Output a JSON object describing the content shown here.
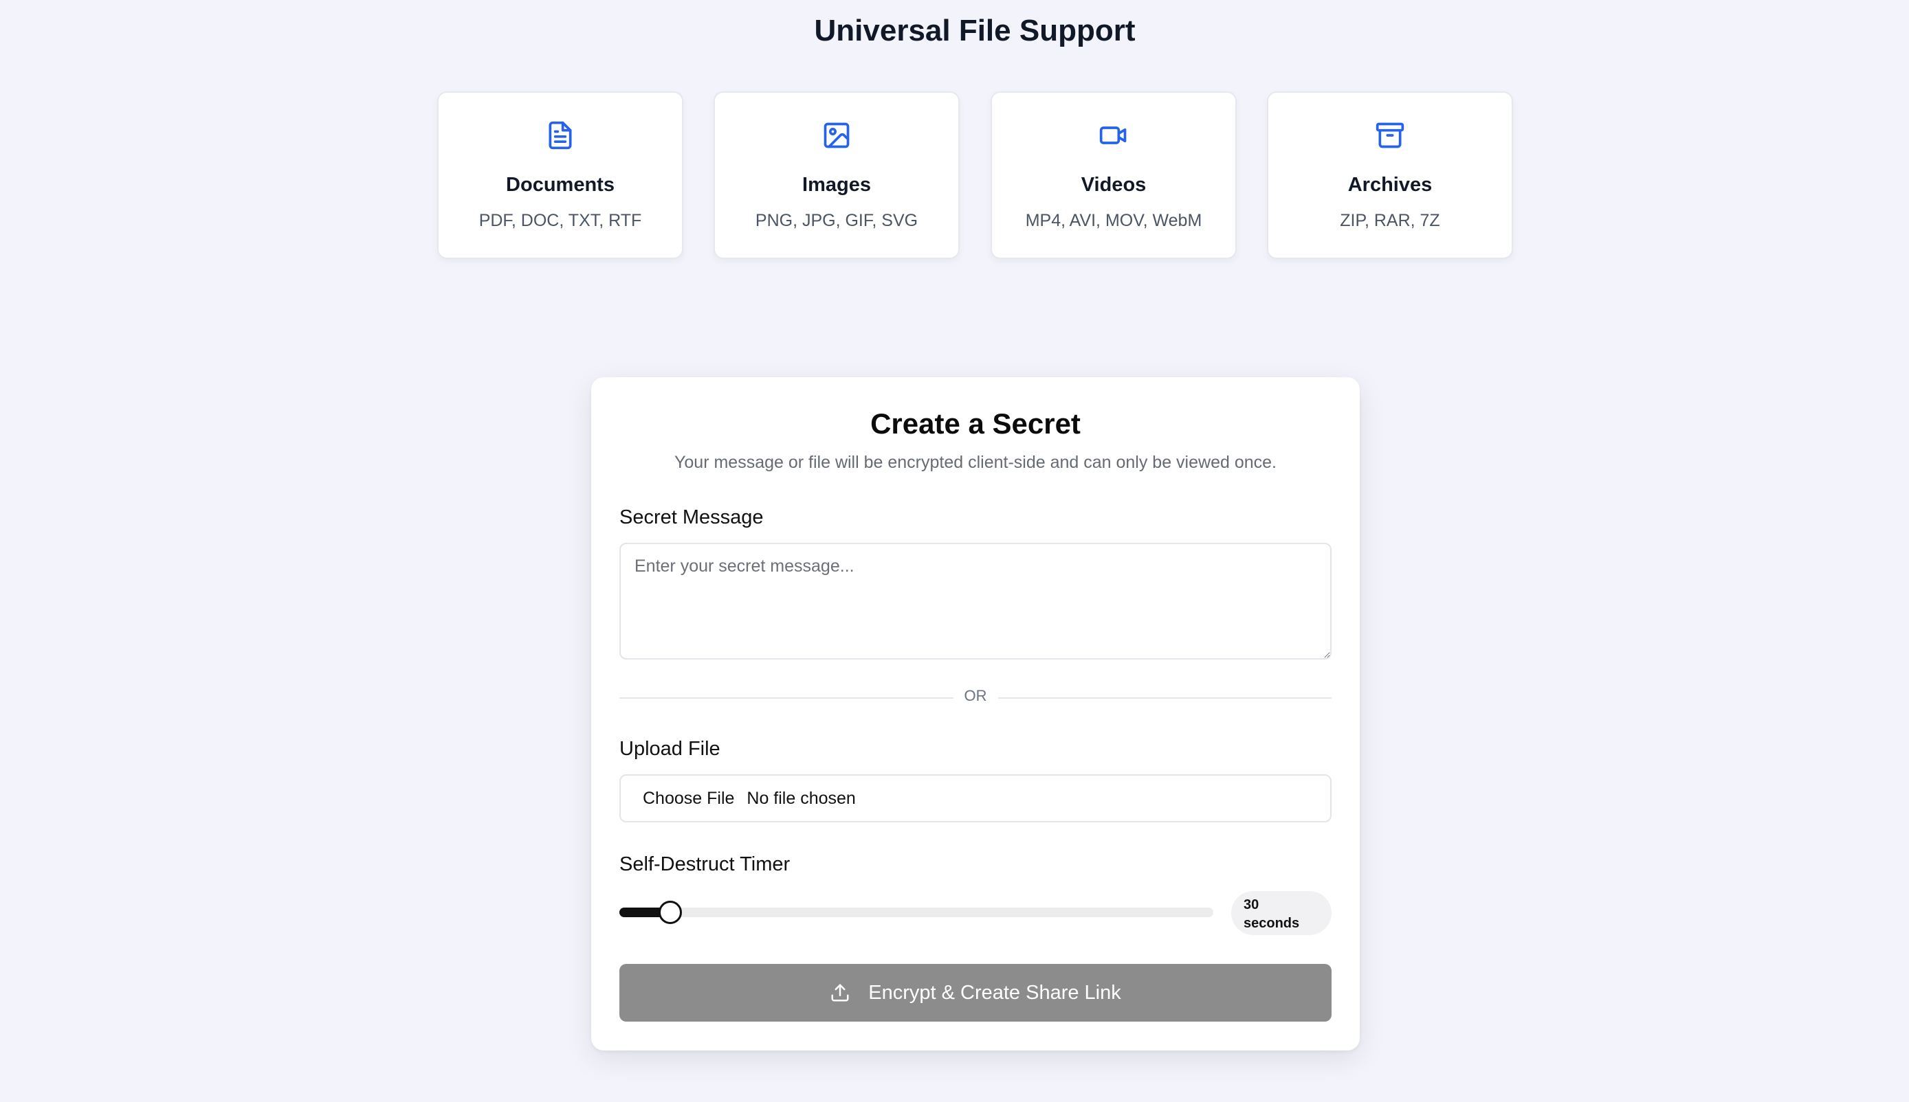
{
  "file_support": {
    "title": "Universal File Support",
    "cards": [
      {
        "icon": "document-icon",
        "title": "Documents",
        "formats": "PDF, DOC, TXT, RTF"
      },
      {
        "icon": "image-icon",
        "title": "Images",
        "formats": "PNG, JPG, GIF, SVG"
      },
      {
        "icon": "video-icon",
        "title": "Videos",
        "formats": "MP4, AVI, MOV, WebM"
      },
      {
        "icon": "archive-icon",
        "title": "Archives",
        "formats": "ZIP, RAR, 7Z"
      }
    ]
  },
  "form": {
    "title": "Create a Secret",
    "subtitle": "Your message or file will be encrypted client-side and can only be viewed once.",
    "message_label": "Secret Message",
    "message_placeholder": "Enter your secret message...",
    "message_value": "",
    "divider_text": "OR",
    "upload_label": "Upload File",
    "choose_file_label": "Choose File",
    "file_status": "No file chosen",
    "timer_label": "Self-Destruct Timer",
    "timer_value_text": "30",
    "timer_unit_text": "seconds",
    "timer_slider_fraction": 0.086,
    "submit_label": "Encrypt & Create Share Link",
    "submit_icon": "upload-icon"
  },
  "colors": {
    "accent_icon": "#2563eb",
    "button_disabled": "#8c8c8c",
    "slider_active": "#111111"
  }
}
